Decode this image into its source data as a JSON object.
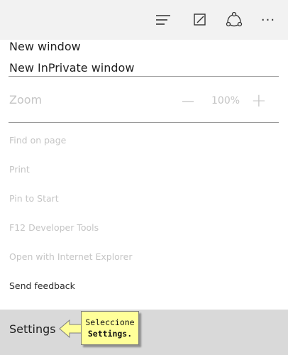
{
  "toolbar": {
    "icons": [
      "hub-icon",
      "web-note-icon",
      "share-icon",
      "more-actions-icon"
    ],
    "more_label": "···"
  },
  "menu": {
    "new_window": "New window",
    "new_inprivate_window": "New InPrivate window",
    "zoom": {
      "label": "Zoom",
      "minus": "—",
      "value": "100%",
      "plus": "+"
    },
    "find_on_page": "Find on page",
    "print": "Print",
    "pin_to_start": "Pin to Start",
    "f12_developer_tools": "F12 Developer Tools",
    "open_with_ie": "Open with Internet Explorer",
    "send_feedback": "Send feedback",
    "settings": "Settings"
  },
  "callout": {
    "line1": "Seleccione",
    "line2": "Settings."
  },
  "colors": {
    "toolbar_bg": "#f2f2f2",
    "settings_highlight": "#d9d9d9",
    "callout_bg": "#ffff99",
    "disabled_text": "#c5c5c5"
  }
}
